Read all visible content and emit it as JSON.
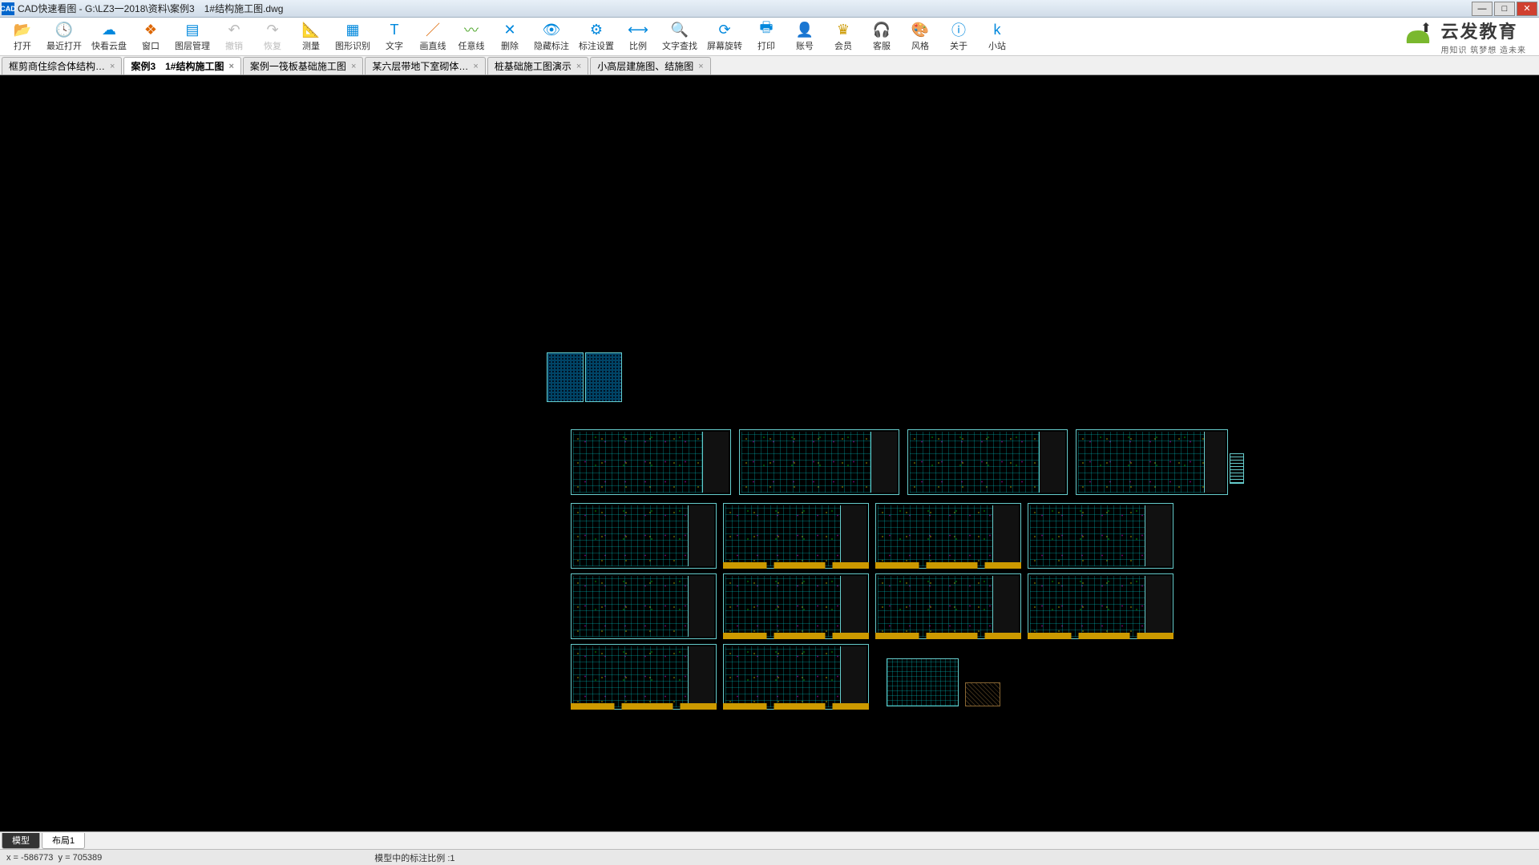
{
  "title": "CAD快速看图 - G:\\LZ3一2018\\资料\\案例3　1#结构施工图.dwg",
  "toolbar": [
    {
      "id": "open",
      "label": "打开",
      "icon": "📂",
      "color": "accent-blue"
    },
    {
      "id": "recent",
      "label": "最近打开",
      "icon": "🕓",
      "color": "accent-blue"
    },
    {
      "id": "cloud",
      "label": "快看云盘",
      "icon": "☁",
      "color": "accent-blue"
    },
    {
      "id": "window",
      "label": "窗口",
      "icon": "❖",
      "color": "accent-orange"
    },
    {
      "id": "layer",
      "label": "图层管理",
      "icon": "▤",
      "color": "accent-blue"
    },
    {
      "id": "undo",
      "label": "撤销",
      "icon": "↶",
      "disabled": true
    },
    {
      "id": "redo",
      "label": "恢复",
      "icon": "↷",
      "disabled": true
    },
    {
      "id": "measure",
      "label": "测量",
      "icon": "📐",
      "color": "accent-blue"
    },
    {
      "id": "recognize",
      "label": "图形识别",
      "icon": "▦",
      "color": "accent-blue"
    },
    {
      "id": "text",
      "label": "文字",
      "icon": "T",
      "color": "accent-blue"
    },
    {
      "id": "line",
      "label": "画直线",
      "icon": "／",
      "color": "accent-orange"
    },
    {
      "id": "freeline",
      "label": "任意线",
      "icon": "〰",
      "color": "accent-green"
    },
    {
      "id": "delete",
      "label": "删除",
      "icon": "✕",
      "color": "accent-blue"
    },
    {
      "id": "hide",
      "label": "隐藏标注",
      "icon": "👁",
      "color": "accent-blue"
    },
    {
      "id": "dimset",
      "label": "标注设置",
      "icon": "⚙",
      "color": "accent-blue"
    },
    {
      "id": "scale",
      "label": "比例",
      "icon": "⟷",
      "color": "accent-blue"
    },
    {
      "id": "findtext",
      "label": "文字查找",
      "icon": "🔍",
      "color": "accent-blue"
    },
    {
      "id": "rotate",
      "label": "屏幕旋转",
      "icon": "⟳",
      "color": "accent-blue"
    },
    {
      "id": "print",
      "label": "打印",
      "icon": "🖶",
      "color": "accent-blue"
    },
    {
      "id": "account",
      "label": "账号",
      "icon": "👤",
      "color": "accent-blue"
    },
    {
      "id": "vip",
      "label": "会员",
      "icon": "♛",
      "color": "vip"
    },
    {
      "id": "support",
      "label": "客服",
      "icon": "🎧",
      "color": "accent-blue"
    },
    {
      "id": "style",
      "label": "风格",
      "icon": "🎨",
      "color": "accent-blue"
    },
    {
      "id": "about",
      "label": "关于",
      "icon": "ⓘ",
      "color": "accent-blue"
    },
    {
      "id": "site",
      "label": "小站",
      "icon": "k",
      "color": "accent-blue"
    }
  ],
  "brand": {
    "title": "云发教育",
    "sub": "用知识 筑梦想 造未来"
  },
  "tabs": [
    {
      "label": "框剪商住综合体结构…",
      "active": false
    },
    {
      "label": "案例3　1#结构施工图",
      "active": true
    },
    {
      "label": "案例一筏板基础施工图",
      "active": false
    },
    {
      "label": "某六层带地下室砌体…",
      "active": false
    },
    {
      "label": "桩基础施工图演示",
      "active": false
    },
    {
      "label": "小高层建施图、结施图",
      "active": false
    }
  ],
  "layoutTabs": [
    {
      "label": "模型",
      "active": true
    },
    {
      "label": "布局1",
      "active": false
    }
  ],
  "status": {
    "coord_x": "-586773",
    "coord_y": "705389",
    "scale_label": "模型中的标注比例 :1"
  }
}
